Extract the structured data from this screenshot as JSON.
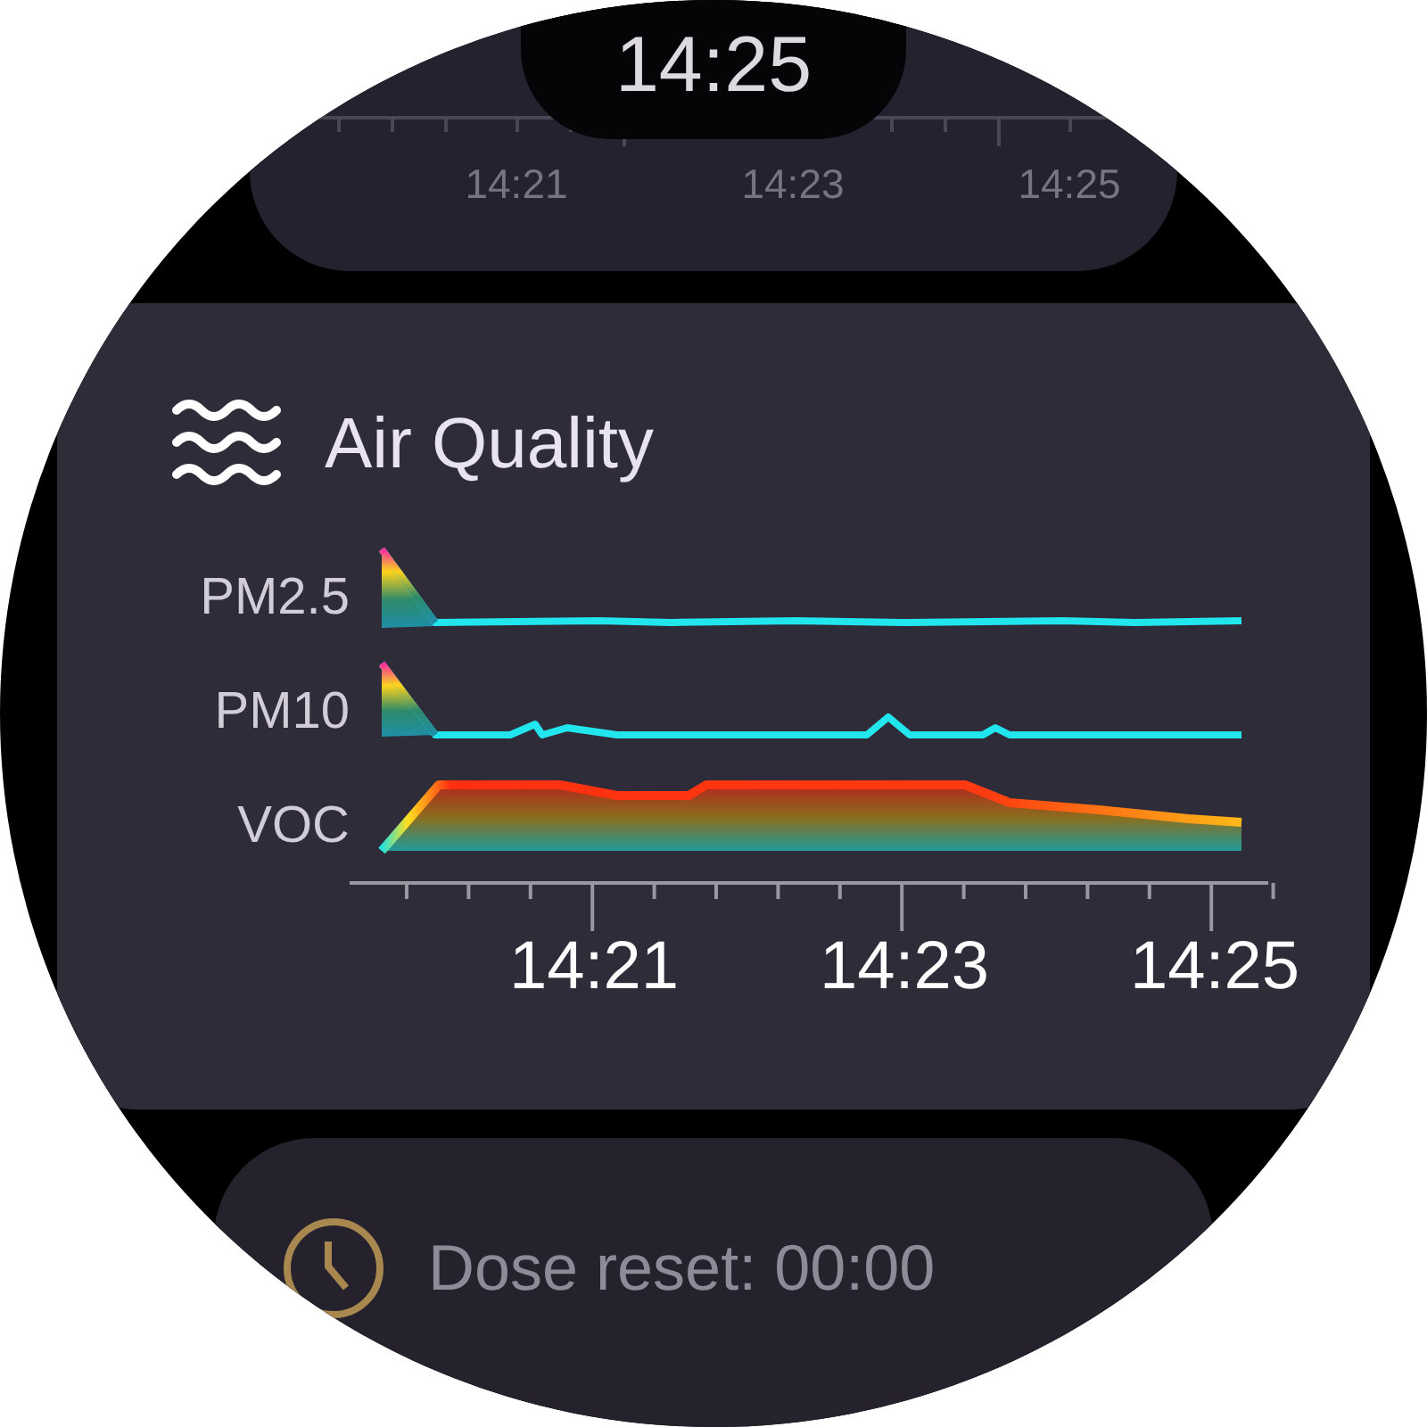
{
  "clock": {
    "time": "14:25"
  },
  "top_card": {
    "axis_labels": [
      "14:21",
      "14:23",
      "14:25"
    ]
  },
  "air_quality": {
    "title": "Air Quality",
    "series": [
      {
        "label": "PM2.5"
      },
      {
        "label": "PM10"
      },
      {
        "label": "VOC"
      }
    ],
    "axis_labels": [
      "14:21",
      "14:23",
      "14:25"
    ]
  },
  "dose": {
    "text": "Dose reset: 00:00"
  }
}
